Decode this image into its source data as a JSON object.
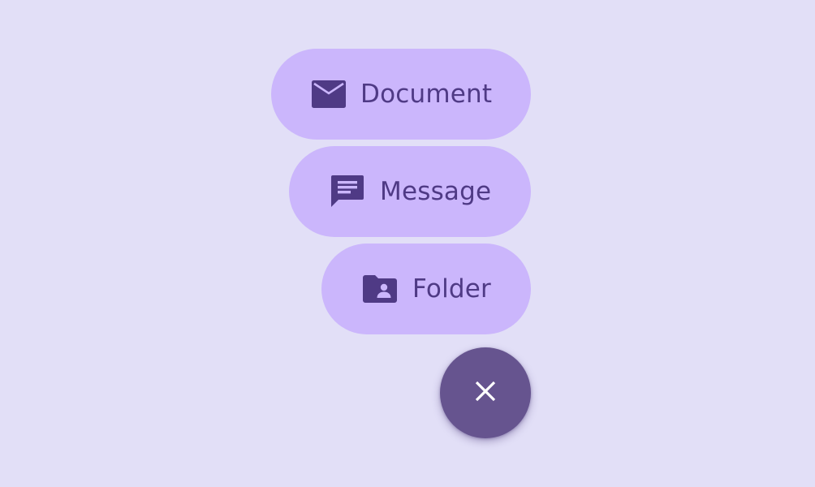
{
  "colors": {
    "background": "#E2DFF7",
    "menu_item_bg": "#CBB6FC",
    "menu_item_fg": "#4F3A85",
    "fab_bg": "#66548F",
    "fab_icon": "#FFFFFF"
  },
  "fab_menu": {
    "items": [
      {
        "label": "Document",
        "icon": "mail-icon"
      },
      {
        "label": "Message",
        "icon": "chat-message-icon"
      },
      {
        "label": "Folder",
        "icon": "shared-folder-icon"
      }
    ],
    "close_button": {
      "icon": "close-icon"
    }
  }
}
